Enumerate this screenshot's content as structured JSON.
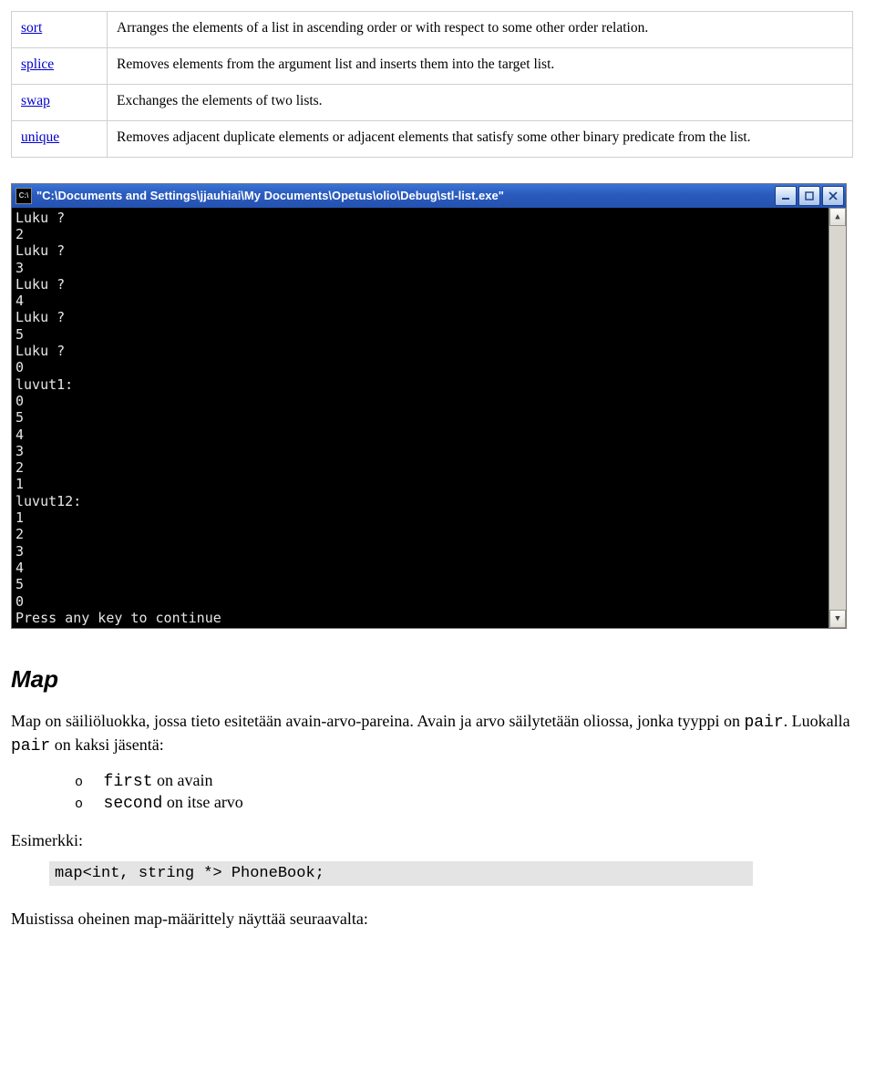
{
  "func_table": [
    {
      "name": "sort",
      "desc": "Arranges the elements of a list in ascending order or with respect to some other order relation."
    },
    {
      "name": "splice",
      "desc": "Removes elements from the argument list and inserts them into the target list."
    },
    {
      "name": "swap",
      "desc": "Exchanges the elements of two lists."
    },
    {
      "name": "unique",
      "desc": "Removes adjacent duplicate elements or adjacent elements that satisfy some other binary predicate from the list."
    }
  ],
  "console": {
    "title": "\"C:\\Documents and Settings\\jjauhiai\\My Documents\\Opetus\\olio\\Debug\\stl-list.exe\"",
    "cmd_icon_label": "C:\\",
    "output": "Luku ?\n2\nLuku ?\n3\nLuku ?\n4\nLuku ?\n5\nLuku ?\n0\nluvut1:\n0\n5\n4\n3\n2\n1\nluvut12:\n1\n2\n3\n4\n5\n0\nPress any key to continue"
  },
  "section_heading": "Map",
  "para1_a": "Map on säiliöluokka, jossa tieto esitetään avain-arvo-pareina. Avain ja arvo säilytetään oliossa, jonka tyyppi on ",
  "para1_code": "pair",
  "para1_b": ". Luokalla ",
  "para1_code2": "pair",
  "para1_c": " on kaksi jäsentä:",
  "members": {
    "first_code": "first",
    "first_text": " on avain",
    "second_code": "second",
    "second_text": " on itse arvo"
  },
  "example_label": "Esimerkki:",
  "code_block": "map<int, string *> PhoneBook;",
  "closing": "Muistissa oheinen map-määrittely näyttää seuraavalta:"
}
